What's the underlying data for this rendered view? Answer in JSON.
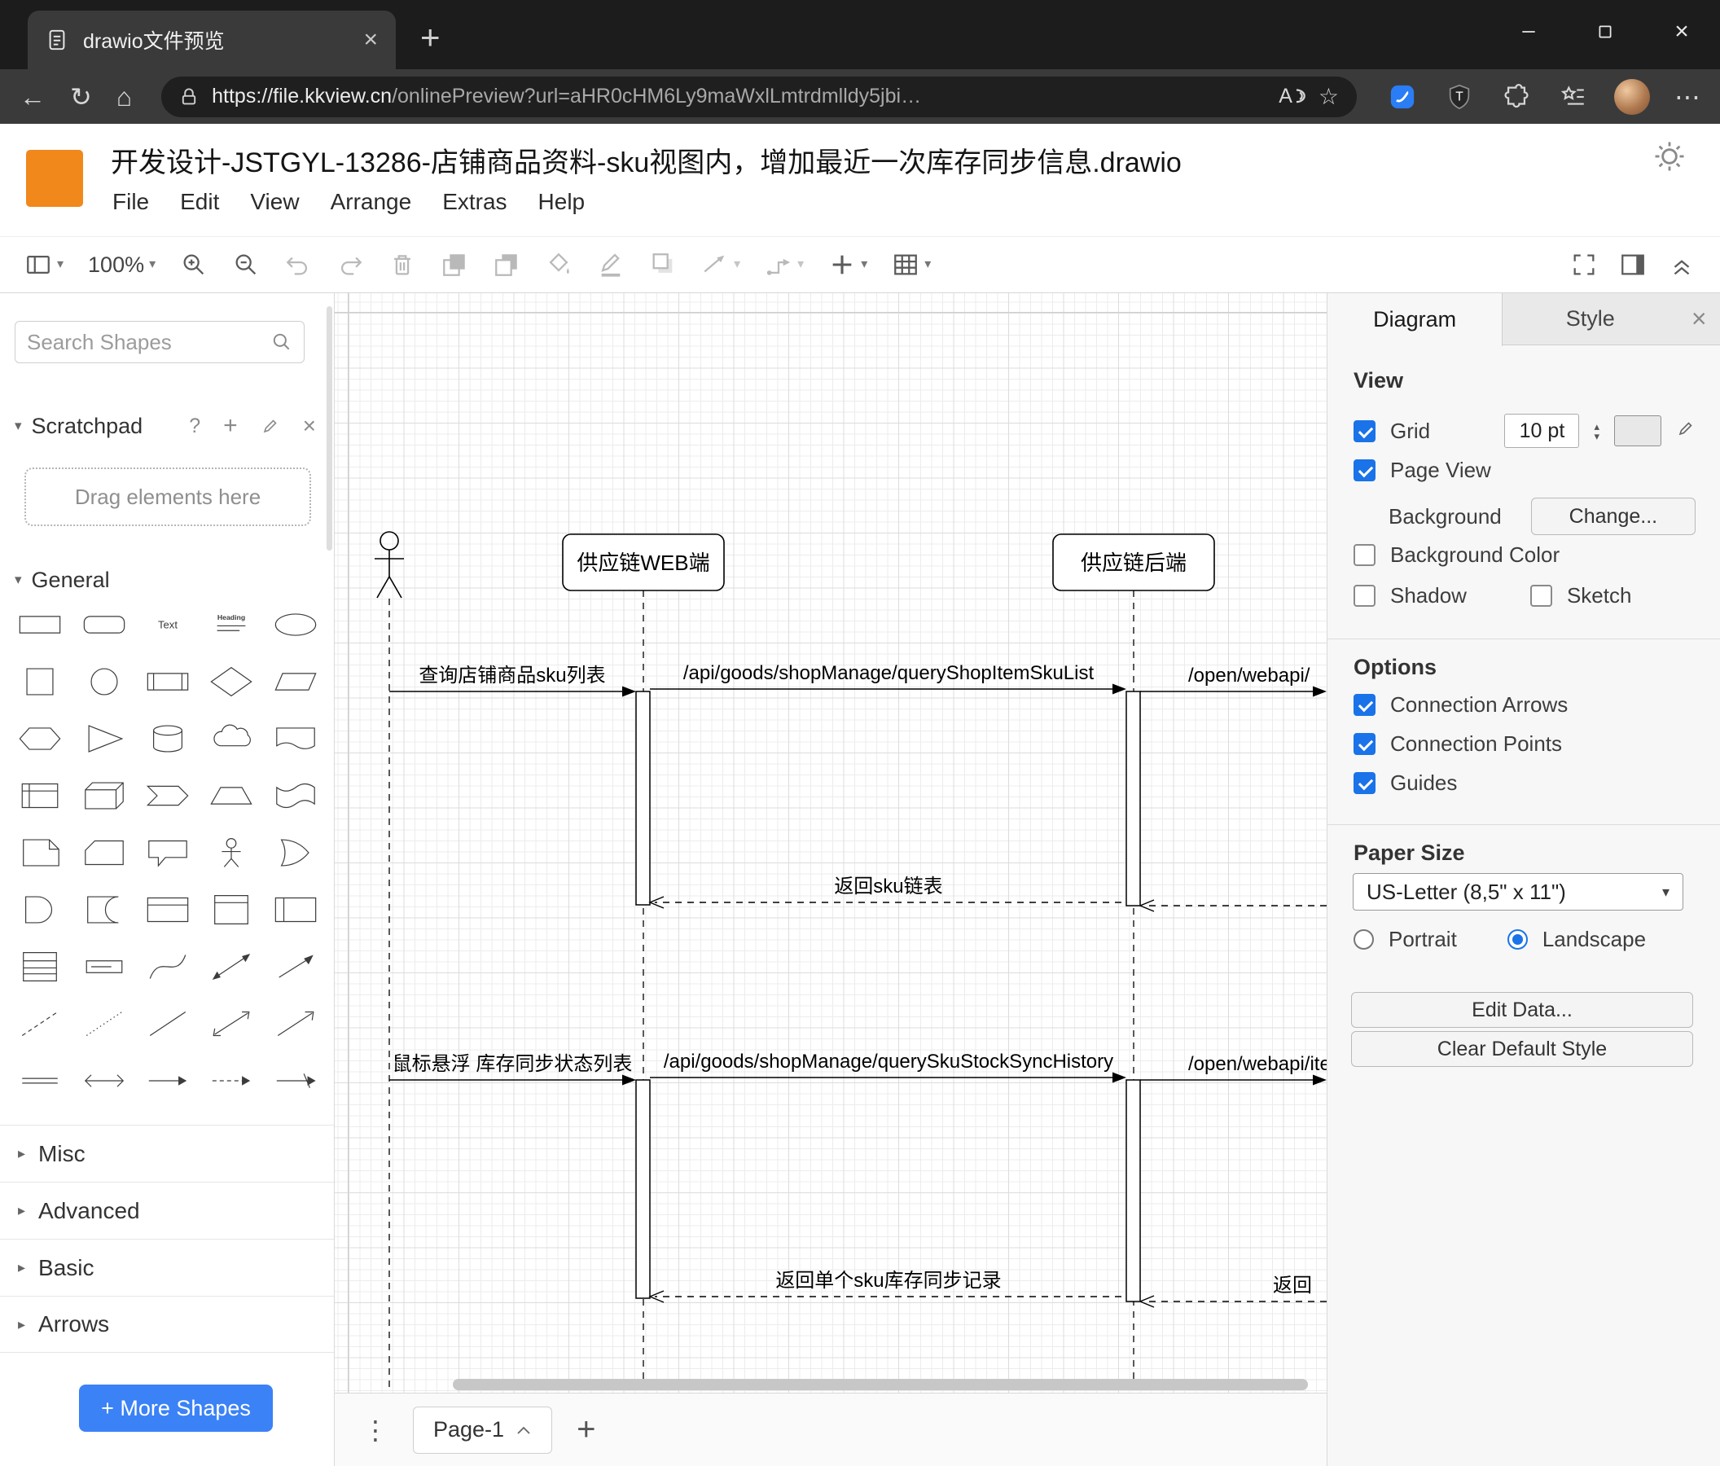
{
  "colors": {
    "accent_blue": "#1a73e8",
    "logo_orange": "#f0881b",
    "more_shapes_blue": "#3b82f6"
  },
  "icons": {
    "tab_close": "×",
    "new_tab": "+",
    "window_close": "×",
    "back": "←",
    "refresh": "↻",
    "home": "⌂",
    "star": "☆",
    "more": "⋯",
    "read_aloud": "A",
    "caret_down": "▾",
    "section_chevron": "▸",
    "stepper_up": "▴",
    "stepper_down": "▾",
    "scratch_help": "?",
    "scratch_add": "+",
    "scratch_close": "×",
    "panel_close": "×",
    "pagebar_overflow": "⋮",
    "pagebar_add": "+"
  },
  "browser": {
    "tab_title": "drawio文件预览",
    "url_host": "https://file.kkview.cn",
    "url_path": "/onlinePreview?url=aHR0cHM6Ly9maWxlLmtrdmlldy5jbi…"
  },
  "app": {
    "title": "开发设计-JSTGYL-13286-店铺商品资料-sku视图内，增加最近一次库存同步信息.drawio",
    "menu": [
      "File",
      "Edit",
      "View",
      "Arrange",
      "Extras",
      "Help"
    ],
    "zoom": "100%"
  },
  "sidebar": {
    "search_placeholder": "Search Shapes",
    "scratchpad": "Scratchpad",
    "drag_hint": "Drag elements here",
    "general": "General",
    "sections": [
      "Misc",
      "Advanced",
      "Basic",
      "Arrows"
    ],
    "more_shapes": "+ More Shapes",
    "shape_labels": {
      "text": "Text",
      "heading": "Heading"
    },
    "general_shapes": [
      "rectangle",
      "rounded-rectangle",
      "text",
      "textbox",
      "ellipse",
      "square",
      "circle",
      "process",
      "diamond",
      "parallelogram",
      "hexagon",
      "triangle",
      "cylinder",
      "cloud",
      "document",
      "internal-storage",
      "cube",
      "step",
      "trapezoid",
      "tape",
      "note",
      "card",
      "callout",
      "actor",
      "or",
      "and",
      "data-storage",
      "container",
      "vertical-container",
      "horizontal-container",
      "list",
      "list-item",
      "curve",
      "bidirectional-arrow",
      "arrow",
      "dashed-line",
      "dotted-line",
      "line",
      "bidirectional-connector",
      "directional-connector",
      "link",
      "double-arrow",
      "arrow-edge",
      "dashed-arrow-edge",
      "cross-arrow-edge"
    ]
  },
  "canvas": {
    "page_tab": "Page-1",
    "diagram": {
      "lifelines": [
        {
          "label": "供应链WEB端"
        },
        {
          "label": "供应链后端"
        }
      ],
      "messages": [
        {
          "label": "查询店铺商品sku列表"
        },
        {
          "label": "/api/goods/shopManage/queryShopItemSkuList"
        },
        {
          "label": "/open/webapi/"
        },
        {
          "label": "返回sku链表"
        },
        {
          "label": "鼠标悬浮 库存同步状态列表"
        },
        {
          "label": "/api/goods/shopManage/querySkuStockSyncHistory"
        },
        {
          "label": "/open/webapi/item"
        },
        {
          "label": "返回单个sku库存同步记录"
        },
        {
          "label": "返回"
        }
      ]
    }
  },
  "format_panel": {
    "tabs": [
      {
        "label": "Diagram"
      },
      {
        "label": "Style"
      }
    ],
    "view": {
      "title": "View",
      "grid": "Grid",
      "grid_size": "10 pt",
      "page_view": "Page View",
      "background": "Background",
      "change": "Change...",
      "background_color": "Background Color",
      "shadow": "Shadow",
      "sketch": "Sketch"
    },
    "options": {
      "title": "Options",
      "connection_arrows": "Connection Arrows",
      "connection_points": "Connection Points",
      "guides": "Guides"
    },
    "paper": {
      "title": "Paper Size",
      "size": "US-Letter (8,5\" x 11\")",
      "portrait": "Portrait",
      "landscape": "Landscape"
    },
    "edit_data": "Edit Data...",
    "clear_default_style": "Clear Default Style"
  }
}
